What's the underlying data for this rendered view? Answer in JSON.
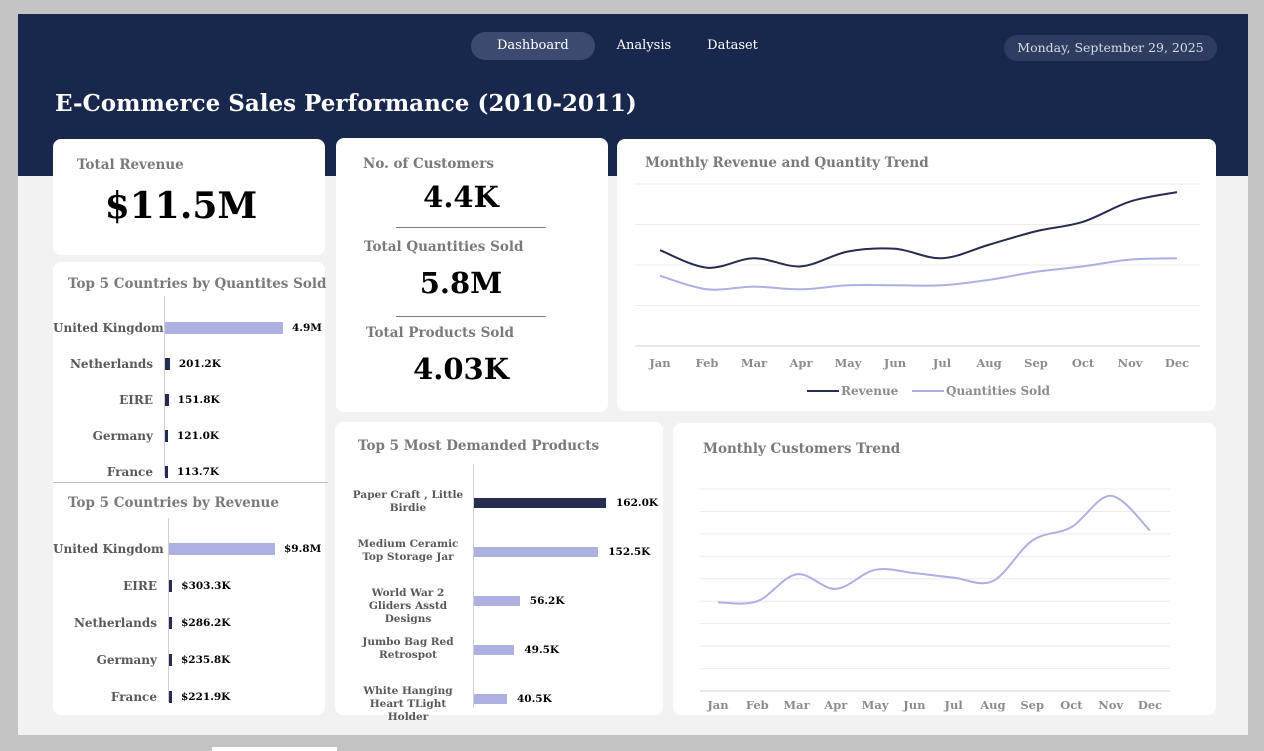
{
  "nav": {
    "items": [
      "Dashboard",
      "Analysis",
      "Dataset"
    ],
    "active": "Dashboard"
  },
  "date": "Monday, September 29, 2025",
  "title": "E-Commerce Sales Performance (2010-2011)",
  "colors": {
    "header": "#18284c",
    "dark_series": "#262c52",
    "light_series": "#aeb0e2"
  },
  "kpis": {
    "total_revenue": {
      "label": "Total Revenue",
      "value": "$11.5M"
    },
    "customers": {
      "label": "No. of Customers",
      "value": "4.4K"
    },
    "quantities": {
      "label": "Total Quantities Sold",
      "value": "5.8M"
    },
    "products": {
      "label": "Total Products Sold",
      "value": "4.03K"
    }
  },
  "top_qty": {
    "title": "Top 5 Countries by Quantites Sold",
    "rows": [
      {
        "label": "United Kingdom",
        "value": 4.9,
        "display": "4.9M"
      },
      {
        "label": "Netherlands",
        "value": 0.2012,
        "display": "201.2K"
      },
      {
        "label": "EIRE",
        "value": 0.1518,
        "display": "151.8K"
      },
      {
        "label": "Germany",
        "value": 0.121,
        "display": "121.0K"
      },
      {
        "label": "France",
        "value": 0.1137,
        "display": "113.7K"
      }
    ]
  },
  "top_rev": {
    "title": "Top 5 Countries by Revenue",
    "rows": [
      {
        "label": "United Kingdom",
        "value": 9.8,
        "display": "$9.8M"
      },
      {
        "label": "EIRE",
        "value": 0.3033,
        "display": "$303.3K"
      },
      {
        "label": "Netherlands",
        "value": 0.2862,
        "display": "$286.2K"
      },
      {
        "label": "Germany",
        "value": 0.2358,
        "display": "$235.8K"
      },
      {
        "label": "France",
        "value": 0.2219,
        "display": "$221.9K"
      }
    ]
  },
  "top_products": {
    "title": "Top 5 Most Demanded Products",
    "rows": [
      {
        "label": "Paper Craft , Little Birdie",
        "value": 162.0,
        "display": "162.0K"
      },
      {
        "label": "Medium Ceramic Top Storage Jar",
        "value": 152.5,
        "display": "152.5K"
      },
      {
        "label": "World War 2 Gliders Asstd Designs",
        "value": 56.2,
        "display": "56.2K"
      },
      {
        "label": "Jumbo Bag Red Retrospot",
        "value": 49.5,
        "display": "49.5K"
      },
      {
        "label": "White Hanging Heart TLight Holder",
        "value": 40.5,
        "display": "40.5K"
      }
    ]
  },
  "chart_data": [
    {
      "type": "line",
      "title": "Monthly Revenue and Quantity Trend",
      "categories": [
        "Jan",
        "Feb",
        "Mar",
        "Apr",
        "May",
        "Jun",
        "Jul",
        "Aug",
        "Sep",
        "Oct",
        "Nov",
        "Dec"
      ],
      "series": [
        {
          "name": "Revenue",
          "color": "#262c52",
          "values": [
            0.71,
            0.58,
            0.65,
            0.59,
            0.7,
            0.72,
            0.65,
            0.75,
            0.85,
            0.92,
            1.07,
            1.14
          ]
        },
        {
          "name": "Quantities Sold",
          "color": "#aeb0e2",
          "values": [
            0.52,
            0.42,
            0.44,
            0.42,
            0.45,
            0.45,
            0.45,
            0.49,
            0.55,
            0.59,
            0.64,
            0.65
          ]
        }
      ],
      "ylim": [
        0,
        1.2
      ],
      "grid": true,
      "legend": "bottom"
    },
    {
      "type": "line",
      "title": "Monthly Customers Trend",
      "categories": [
        "Jan",
        "Feb",
        "Mar",
        "Apr",
        "May",
        "Jun",
        "Jul",
        "Aug",
        "Sep",
        "Oct",
        "Nov",
        "Dec"
      ],
      "series": [
        {
          "color": "#aeb0e2",
          "values": [
            3.95,
            4.0,
            5.2,
            4.55,
            5.4,
            5.25,
            5.05,
            4.9,
            6.7,
            7.3,
            8.7,
            7.15
          ]
        }
      ],
      "ylim": [
        0,
        9
      ],
      "grid": true
    }
  ]
}
